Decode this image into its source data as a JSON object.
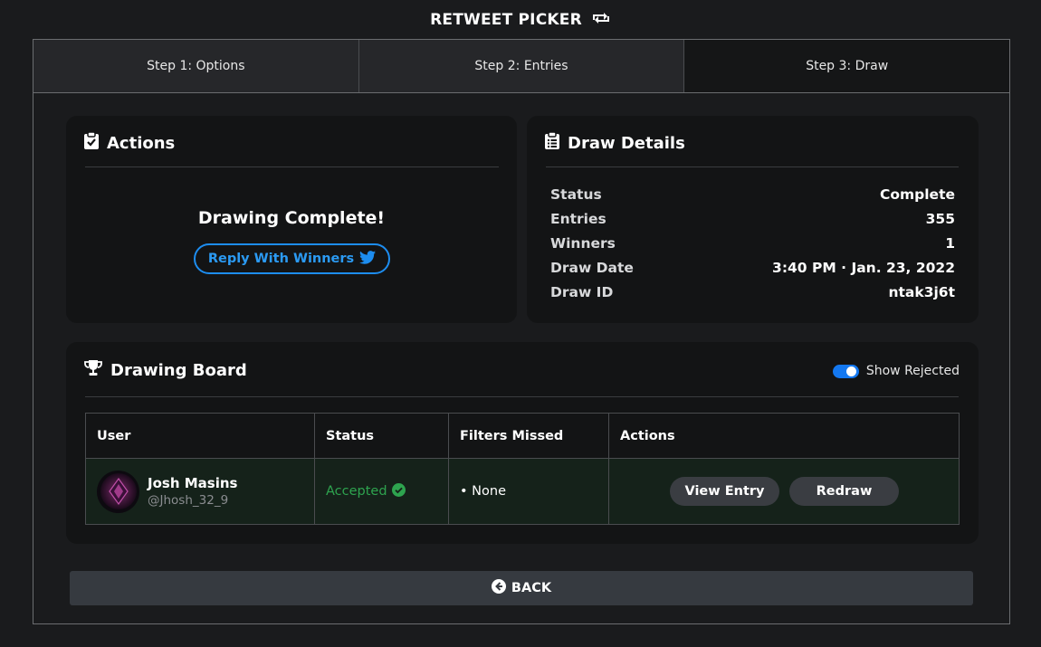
{
  "app": {
    "title": "RETWEET PICKER",
    "title_icon": "retweet-icon"
  },
  "tabs": [
    {
      "label": "Step 1: Options"
    },
    {
      "label": "Step 2: Entries"
    },
    {
      "label": "Step 3: Draw",
      "active": true
    }
  ],
  "actions": {
    "title": "Actions",
    "icon": "clipboard-check-icon",
    "message": "Drawing Complete!",
    "reply_button": "Reply With Winners",
    "reply_icon": "twitter-icon"
  },
  "details": {
    "title": "Draw Details",
    "icon": "clipboard-list-icon",
    "rows": [
      {
        "label": "Status",
        "value": "Complete"
      },
      {
        "label": "Entries",
        "value": "355"
      },
      {
        "label": "Winners",
        "value": "1"
      },
      {
        "label": "Draw Date",
        "value": "3:40 PM · Jan. 23, 2022"
      },
      {
        "label": "Draw ID",
        "value": "ntak3j6t"
      }
    ]
  },
  "board": {
    "title": "Drawing Board",
    "icon": "trophy-icon",
    "toggle_label": "Show Rejected",
    "toggle_on": true,
    "columns": [
      "User",
      "Status",
      "Filters Missed",
      "Actions"
    ],
    "rows": [
      {
        "name": "Josh Masins",
        "handle": "@Jhosh_32_9",
        "status": "Accepted",
        "filters_missed": "• None",
        "view_button": "View Entry",
        "redraw_button": "Redraw"
      }
    ]
  },
  "back_button": "BACK",
  "colors": {
    "background": "#1a1b1d",
    "card": "#131415",
    "accent_blue": "#1d8df0",
    "accepted_green": "#2ea44f",
    "row_bg": "#15221a"
  }
}
